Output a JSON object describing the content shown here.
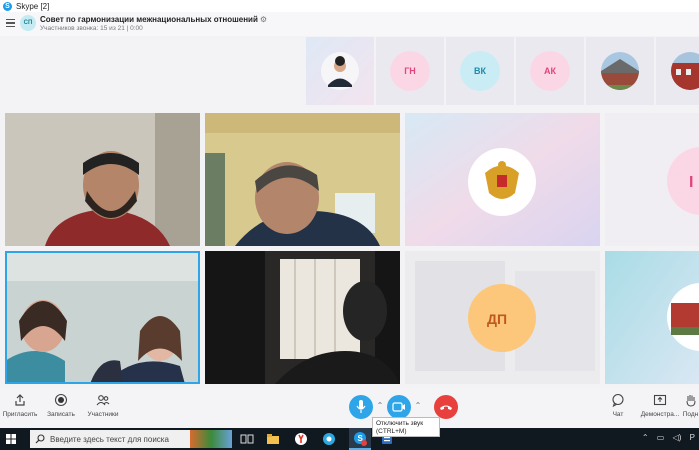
{
  "window": {
    "title": "Skype [2]"
  },
  "header": {
    "avatar_initials": "СП",
    "title": "Совет по гармонизации межнациональных отношений",
    "subtitle": "Участников звонка: 15 из 21 | 0:00"
  },
  "participants_strip": [
    {
      "kind": "photo"
    },
    {
      "kind": "initials",
      "initials": "ГН",
      "bg": "#fbd7e6",
      "fg": "#e0457b"
    },
    {
      "kind": "initials",
      "initials": "ВК",
      "bg": "#c9ecf5",
      "fg": "#1f8aa8"
    },
    {
      "kind": "initials",
      "initials": "АК",
      "bg": "#fbd7e6",
      "fg": "#e0457b"
    },
    {
      "kind": "photo"
    },
    {
      "kind": "photo"
    }
  ],
  "video_tiles": [
    {
      "id": "v1"
    },
    {
      "id": "v2"
    },
    {
      "id": "v3"
    },
    {
      "id": "v4",
      "initials": "I"
    },
    {
      "id": "v5"
    },
    {
      "id": "v6"
    },
    {
      "id": "v7",
      "initials": "ДП"
    },
    {
      "id": "v8"
    }
  ],
  "toolbar": {
    "invite_label": "Пригласить",
    "record_label": "Записать",
    "participants_label": "Участники",
    "chat_label": "Чат",
    "share_label": "Демонстра...",
    "more_label": "Подн",
    "mute_tooltip_line1": "Отключить звук",
    "mute_tooltip_line2": "(CTRL+M)"
  },
  "taskbar": {
    "search_placeholder": "Введите здесь текст для поиска"
  },
  "colors": {
    "accent": "#2ea5e8",
    "hangup": "#e8403d",
    "taskbar": "#101820"
  }
}
